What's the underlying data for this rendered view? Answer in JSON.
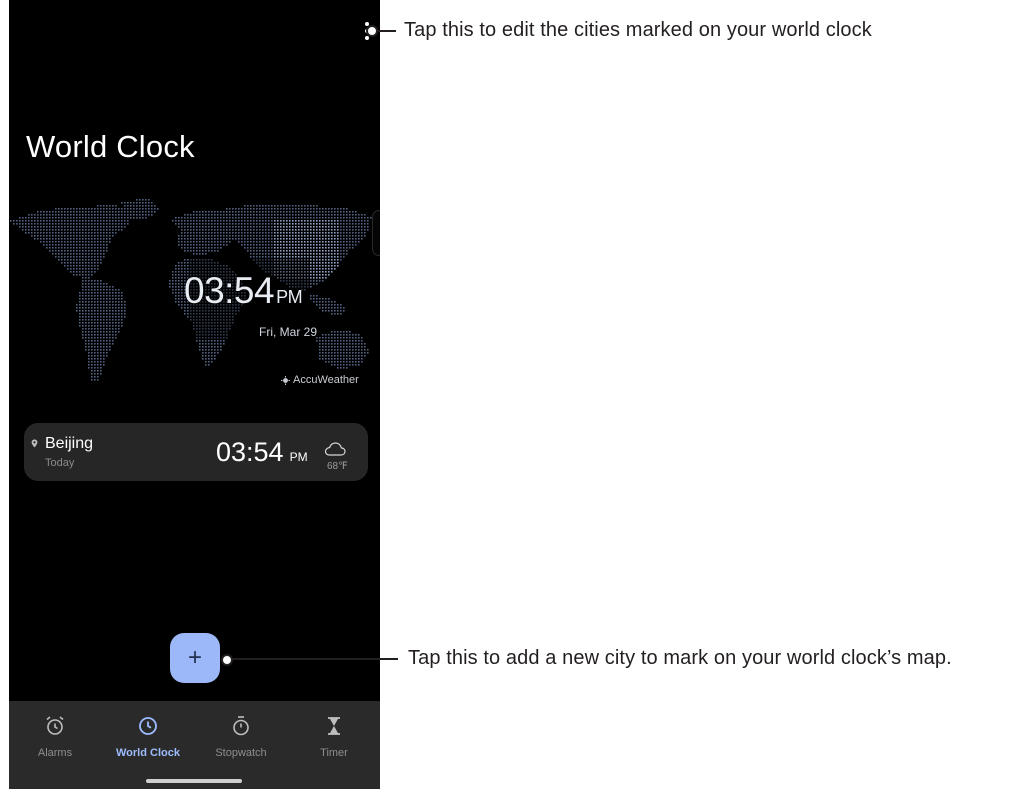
{
  "header": {
    "title": "World Clock",
    "menu_icon": "more-vert-icon"
  },
  "map": {
    "time": "03:54",
    "ampm": "PM",
    "date": "Fri, Mar 29",
    "attribution": "AccuWeather"
  },
  "city_card": {
    "city": "Beijing",
    "day": "Today",
    "time": "03:54",
    "ampm": "PM",
    "temperature": "68℉",
    "weather_icon": "cloud-icon"
  },
  "fab": {
    "label": "+"
  },
  "bottom_nav": {
    "items": [
      {
        "label": "Alarms",
        "icon": "alarm-clock-icon",
        "active": false
      },
      {
        "label": "World Clock",
        "icon": "clock-icon",
        "active": true
      },
      {
        "label": "Stopwatch",
        "icon": "stopwatch-icon",
        "active": false
      },
      {
        "label": "Timer",
        "icon": "hourglass-icon",
        "active": false
      }
    ]
  },
  "callouts": {
    "menu": "Tap this to edit the cities marked on your world clock",
    "add": "Tap this to add a new city to mark on your world clock’s map."
  },
  "colors": {
    "background": "#000000",
    "card": "#262626",
    "fab": "#9cb8f8",
    "active_tab": "#9dbcff",
    "nav_bar": "#2a2a2a",
    "map_dots": "#5a6c8c"
  }
}
